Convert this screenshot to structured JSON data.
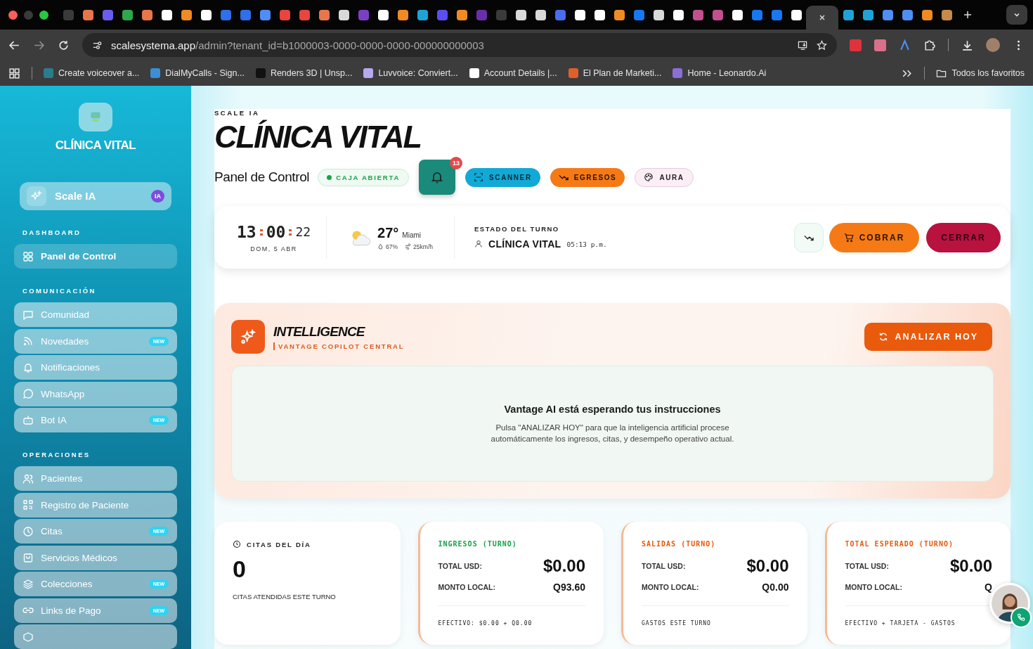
{
  "browser": {
    "tabs": [
      {
        "color": "#3a3a3a",
        "selected": false
      },
      {
        "color": "#e8764a",
        "selected": false
      },
      {
        "color": "#6b5cf0",
        "selected": false
      },
      {
        "color": "#2ea84a",
        "selected": false
      },
      {
        "color": "#e8764a",
        "selected": false
      },
      {
        "color": "#ffffff",
        "selected": false
      },
      {
        "color": "#f08a24",
        "selected": false
      },
      {
        "color": "#ffffff",
        "selected": false
      },
      {
        "color": "#2f6fe8",
        "selected": false
      },
      {
        "color": "#2f6fe8",
        "selected": false
      },
      {
        "color": "#4f8ef7",
        "selected": false
      },
      {
        "color": "#e8453c",
        "selected": false
      },
      {
        "color": "#e8453c",
        "selected": false
      },
      {
        "color": "#e8764a",
        "selected": false
      },
      {
        "color": "#d9d9d9",
        "selected": false
      },
      {
        "color": "#7b3fc4",
        "selected": false
      },
      {
        "color": "#ffffff",
        "selected": false
      },
      {
        "color": "#f08a24",
        "selected": false
      },
      {
        "color": "#1fa3d6",
        "selected": false
      },
      {
        "color": "#5b4ef0",
        "selected": false
      },
      {
        "color": "#f08a24",
        "selected": false
      },
      {
        "color": "#6a2fa8",
        "selected": false
      },
      {
        "color": "#3a3a3a",
        "selected": false
      },
      {
        "color": "#d9d9d9",
        "selected": false
      },
      {
        "color": "#d9d9d9",
        "selected": false
      },
      {
        "color": "#4a6df0",
        "selected": false
      },
      {
        "color": "#ffffff",
        "selected": false
      },
      {
        "color": "#ffffff",
        "selected": false
      },
      {
        "color": "#f08a24",
        "selected": false
      },
      {
        "color": "#1877f2",
        "selected": false
      },
      {
        "color": "#d9d9d9",
        "selected": false
      },
      {
        "color": "#ffffff",
        "selected": false
      },
      {
        "color": "#c2508f",
        "selected": false
      },
      {
        "color": "#c2508f",
        "selected": false
      },
      {
        "color": "#ffffff",
        "selected": false
      },
      {
        "color": "#1877f2",
        "selected": false
      },
      {
        "color": "#1877f2",
        "selected": false
      },
      {
        "color": "#ffffff",
        "selected": false
      },
      {
        "color": "#3c3c3c",
        "selected": true
      },
      {
        "color": "#1fa3d6",
        "selected": false
      },
      {
        "color": "#1fa3d6",
        "selected": false
      },
      {
        "color": "#4f8ef7",
        "selected": false
      },
      {
        "color": "#4f8ef7",
        "selected": false
      },
      {
        "color": "#f08a24",
        "selected": false
      },
      {
        "color": "#c88a4a",
        "selected": false
      }
    ],
    "address": {
      "domain": "scalesystema.app",
      "path": "/admin?tenant_id=b1000003-0000-0000-0000-000000000003"
    },
    "bookmarks": [
      {
        "label": "Create voiceover a...",
        "color": "#2a7d8c"
      },
      {
        "label": "DialMyCalls - Sign...",
        "color": "#3b8fd6"
      },
      {
        "label": "Renders 3D | Unsp...",
        "color": "#111111"
      },
      {
        "label": "Luvvoice: Conviert...",
        "color": "#b9a8f0"
      },
      {
        "label": "Account Details |...",
        "color": "#ffffff"
      },
      {
        "label": "El Plan de Marketi...",
        "color": "#e0602a"
      },
      {
        "label": "Home - Leonardo.Ai",
        "color": "#8b6fd6"
      }
    ],
    "all_bookmarks": "Todos los favoritos"
  },
  "sidebar": {
    "clinic": "CLÍNICA VITAL",
    "assistant": {
      "label": "Scale IA",
      "badge": "IA"
    },
    "sections": [
      {
        "title": "DASHBOARD",
        "items": [
          {
            "label": "Panel de Control",
            "kind": "grid",
            "selected": true
          }
        ]
      },
      {
        "title": "COMUNICACIÓN",
        "items": [
          {
            "label": "Comunidad",
            "kind": "message",
            "selected": false
          },
          {
            "label": "Novedades",
            "kind": "rss",
            "badge": "NEW",
            "selected": false
          },
          {
            "label": "Notificaciones",
            "kind": "bell",
            "selected": false
          },
          {
            "label": "WhatsApp",
            "kind": "chat",
            "selected": false
          },
          {
            "label": "Bot IA",
            "kind": "bot",
            "badge": "NEW",
            "selected": false
          }
        ]
      },
      {
        "title": "OPERACIONES",
        "items": [
          {
            "label": "Pacientes",
            "kind": "users",
            "selected": false
          },
          {
            "label": "Registro de Paciente",
            "kind": "qr",
            "selected": false
          },
          {
            "label": "Citas",
            "kind": "clock",
            "badge": "NEW",
            "selected": false
          },
          {
            "label": "Servicios Médicos",
            "kind": "bag",
            "selected": false
          },
          {
            "label": "Colecciones",
            "kind": "layers",
            "badge": "NEW",
            "selected": false
          },
          {
            "label": "Links de Pago",
            "kind": "link",
            "badge": "NEW",
            "selected": false
          },
          {
            "kind": "box",
            "selected": false
          }
        ]
      }
    ]
  },
  "header": {
    "brand": "SCALE IA",
    "title": "CLÍNICA VITAL",
    "subtitle": "Panel de Control",
    "status": "CAJA ABIERTA",
    "notifications": "13",
    "actions": [
      {
        "label": "SCANNER",
        "kind": "scanner"
      },
      {
        "label": "EGRESOS",
        "kind": "egresos"
      },
      {
        "label": "AURA",
        "kind": "aura"
      }
    ]
  },
  "status_bar": {
    "hours": "13",
    "minutes": "00",
    "seconds": "22",
    "date": "DOM, 5 ABR",
    "temperature": "27°",
    "city": "Miami",
    "humidity": "67%",
    "wind": "25km/h",
    "shift_title": "ESTADO DEL TURNO",
    "shift_name": "CLÍNICA VITAL",
    "shift_time": "05:13 p.m.",
    "charge": "COBRAR",
    "close": "CERRAR"
  },
  "intelligence": {
    "title": "INTELLIGENCE",
    "subtitle": "VANTAGE COPILOT CENTRAL",
    "button": "ANALIZAR HOY",
    "message_title": "Vantage AI está esperando tus instrucciones",
    "message": "Pulsa \"ANALIZAR HOY\" para que la inteligencia artificial procese automáticamente los ingresos, citas, y desempeño operativo actual."
  },
  "cards": [
    {
      "kind": "count",
      "title": "CITAS DEL DÍA",
      "value": "0",
      "caption": "CITAS ATENDIDAS ESTE TURNO"
    },
    {
      "kind": "money",
      "title": "INGRESOS (TURNO)",
      "color": "#16a34a",
      "total_label": "TOTAL USD:",
      "total": "$0.00",
      "local_label": "MONTO LOCAL:",
      "local": "Q93.60",
      "footer": "EFECTIVO: $0.00 + Q0.00"
    },
    {
      "kind": "money",
      "title": "SALIDAS (TURNO)",
      "color": "#ea580c",
      "total_label": "TOTAL USD:",
      "total": "$0.00",
      "local_label": "MONTO LOCAL:",
      "local": "Q0.00",
      "footer": "GASTOS ESTE TURNO"
    },
    {
      "kind": "money",
      "title": "TOTAL ESPERADO (TURNO)",
      "color": "#ea580c",
      "total_label": "TOTAL USD:",
      "total": "$0.00",
      "local_label": "MONTO LOCAL:",
      "local": "Q",
      "footer": "EFECTIVO + TARJETA - GASTOS"
    }
  ]
}
